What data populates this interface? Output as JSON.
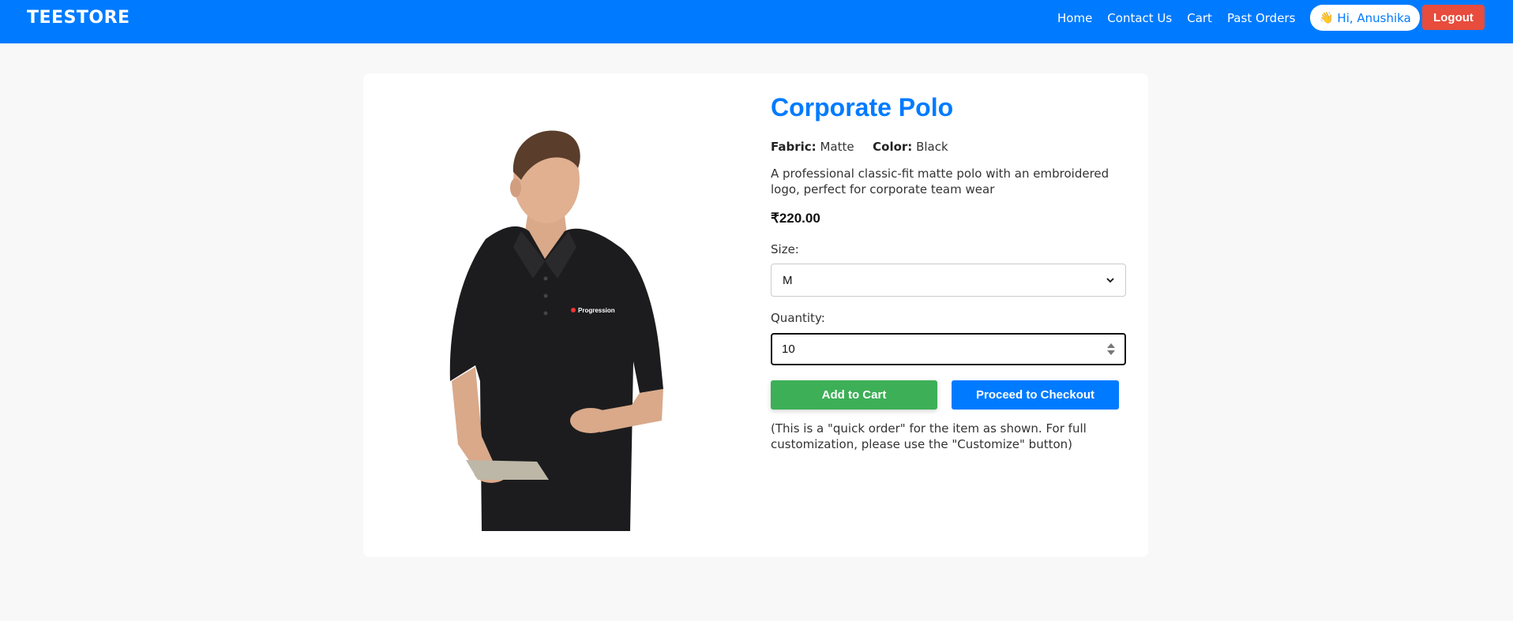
{
  "colors": {
    "navbar": "#007bff",
    "accent": "#007bff",
    "logout": "#e74c3c",
    "add_to_cart": "#3daf57",
    "page_background": "#f8f8f8"
  },
  "header": {
    "brand": "TEESTORE",
    "nav": [
      {
        "label": "Home"
      },
      {
        "label": "Contact Us"
      },
      {
        "label": "Cart"
      },
      {
        "label": "Past Orders"
      }
    ],
    "greeting": "Hi, Anushika",
    "greeting_icon": "waving-hand-icon",
    "logout_label": "Logout"
  },
  "product": {
    "title": "Corporate Polo",
    "fabric_label": "Fabric:",
    "fabric_value": "Matte",
    "color_label": "Color:",
    "color_value": "Black",
    "description": "A professional classic-fit matte polo with an embroidered logo, perfect for corporate team wear",
    "price": "₹220.00",
    "size_label": "Size:",
    "size_selected": "M",
    "quantity_label": "Quantity:",
    "quantity_value": "10",
    "add_to_cart_label": "Add to Cart",
    "checkout_label": "Proceed to Checkout",
    "note": "(This is a \"quick order\" for the item as shown. For full customization, please use the \"Customize\" button)",
    "image_logo_text": "Progression"
  }
}
